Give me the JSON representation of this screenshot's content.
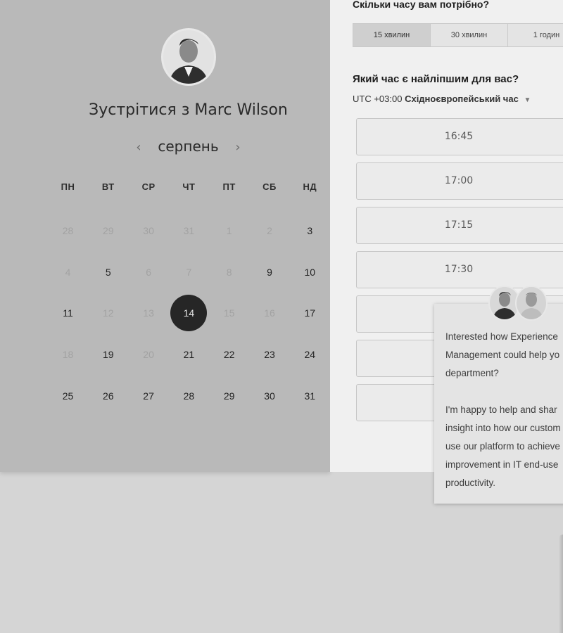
{
  "host": {
    "meet_title": "Зустрітися з Marc Wilson"
  },
  "calendar": {
    "month": "серпень",
    "prev_arrow": "‹",
    "next_arrow": "›",
    "weekdays": [
      "ПН",
      "ВТ",
      "СР",
      "ЧТ",
      "ПТ",
      "СБ",
      "НД"
    ],
    "weeks": [
      [
        "28",
        "29",
        "30",
        "31",
        "1",
        "2",
        "3"
      ],
      [
        "4",
        "5",
        "6",
        "7",
        "8",
        "9",
        "10"
      ],
      [
        "11",
        "12",
        "13",
        "14",
        "15",
        "16",
        "17"
      ],
      [
        "18",
        "19",
        "20",
        "21",
        "22",
        "23",
        "24"
      ],
      [
        "25",
        "26",
        "27",
        "28",
        "29",
        "30",
        "31"
      ]
    ],
    "selected_day": "14"
  },
  "booking": {
    "duration_question": "Скільки часу вам потрібно?",
    "durations": [
      "15 хвилин",
      "30 хвилин",
      "1 годин"
    ],
    "active_duration": "15 хвилин",
    "time_question": "Який час є найліпшим для вас?",
    "timezone_offset": "UTC +03:00",
    "timezone_name": "Східноєвропейський час",
    "slots": [
      "16:45",
      "17:00",
      "17:15",
      "17:30",
      "",
      "",
      ""
    ]
  },
  "chat": {
    "paragraph1": "Interested how Experience Management could help your department?",
    "paragraph1_lines": [
      "Interested how Experience",
      "Management could help yo",
      "department?"
    ],
    "paragraph2_lines": [
      "I'm happy to help and shar",
      "insight into how our custom",
      "use our platform to achieve",
      "improvement in IT end-use",
      "productivity."
    ]
  },
  "icons": {
    "host_avatar": "person-avatar-icon",
    "chat_avatar_1": "person-avatar-icon",
    "chat_avatar_2": "person-avatar-icon",
    "tz_caret": "caret-down-icon"
  }
}
